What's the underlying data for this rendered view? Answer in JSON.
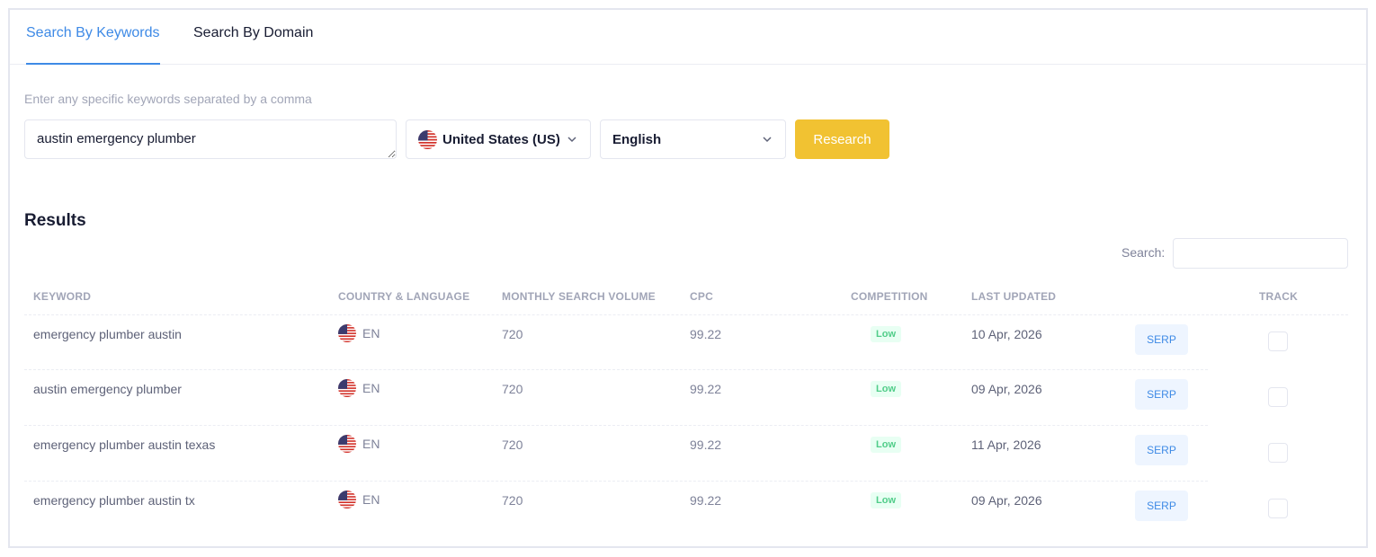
{
  "tabs": [
    {
      "label": "Search By Keywords",
      "active": true
    },
    {
      "label": "Search By Domain",
      "active": false
    }
  ],
  "form": {
    "hint": "Enter any specific keywords separated by a comma",
    "keywords_value": "austin emergency plumber",
    "country": "United States (US)",
    "language": "English",
    "research_label": "Research"
  },
  "results": {
    "title": "Results",
    "search_label": "Search:",
    "columns": [
      "KEYWORD",
      "COUNTRY & LANGUAGE",
      "MONTHLY SEARCH VOLUME",
      "CPC",
      "COMPETITION",
      "LAST UPDATED",
      "TRACK"
    ],
    "rows": [
      {
        "keyword": "emergency plumber austin",
        "lang": "EN",
        "volume": "720",
        "cpc": "99.22",
        "competition": "Low",
        "updated": "10 Apr, 2026",
        "serp": "SERP"
      },
      {
        "keyword": "austin emergency plumber",
        "lang": "EN",
        "volume": "720",
        "cpc": "99.22",
        "competition": "Low",
        "updated": "09 Apr, 2026",
        "serp": "SERP"
      },
      {
        "keyword": "emergency plumber austin texas",
        "lang": "EN",
        "volume": "720",
        "cpc": "99.22",
        "competition": "Low",
        "updated": "11 Apr, 2026",
        "serp": "SERP"
      },
      {
        "keyword": "emergency plumber austin tx",
        "lang": "EN",
        "volume": "720",
        "cpc": "99.22",
        "competition": "Low",
        "updated": "09 Apr, 2026",
        "serp": "SERP"
      }
    ]
  },
  "colors": {
    "accent": "#3e8ae6",
    "research_button": "#f1c232",
    "badge_low_bg": "#e8fff3",
    "badge_low_text": "#50cd89"
  }
}
